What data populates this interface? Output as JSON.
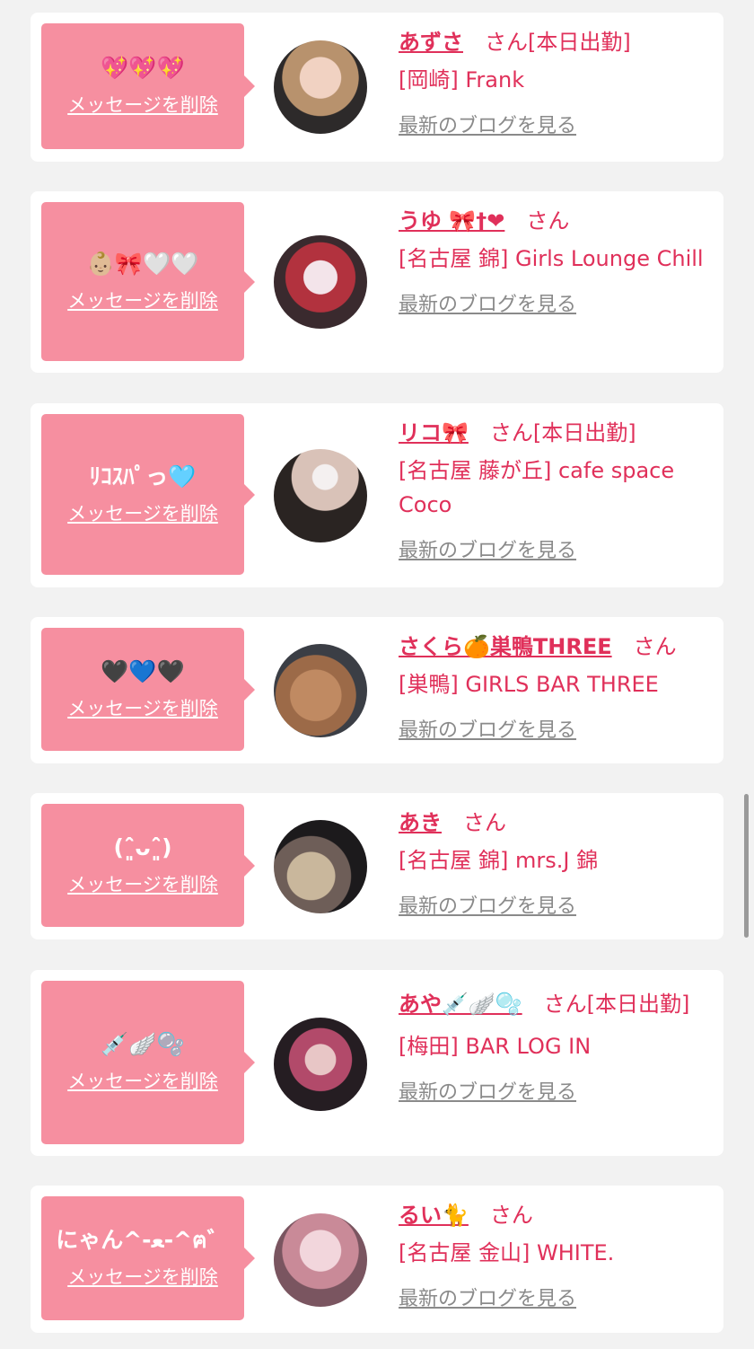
{
  "delete_label": "メッセージを削除",
  "blog_label": "最新のブログを見る",
  "accent_color": "#e0305a",
  "bubble_color": "#f68fa0",
  "cards": [
    {
      "message": "💖💖💖",
      "name": "あずさ",
      "suffix": "さん[本日出勤]",
      "shop": "[岡崎] Frank"
    },
    {
      "message": "👶🏼🎀🤍🤍",
      "name": "うゆ 🎀†❤",
      "suffix": "さん",
      "shop": "[名古屋 錦] Girls Lounge Chill"
    },
    {
      "message": "ﾘｺｽﾊﾟっ🩵",
      "name": "リコ🎀",
      "suffix": "さん[本日出勤]",
      "shop": "[名古屋 藤が丘] cafe space Coco"
    },
    {
      "message": "🖤💙🖤",
      "name": "さくら🍊巣鴨THREE",
      "suffix": "さん",
      "shop": "[巣鴨] GIRLS BAR THREE"
    },
    {
      "message": "(ˆ͈̑ᴗˆ͈̑)",
      "name": "あき",
      "suffix": "さん",
      "shop": "[名古屋 錦] mrs.J 錦"
    },
    {
      "message": "💉🪽🫧",
      "name": "あや💉🪽🫧",
      "suffix": "さん[本日出勤]",
      "shop": "[梅田] BAR LOG IN"
    },
    {
      "message": "にゃん^-ﻌ-^ฅ゛",
      "name": "るい🐈",
      "suffix": "さん",
      "shop": "[名古屋 金山] WHITE."
    }
  ]
}
